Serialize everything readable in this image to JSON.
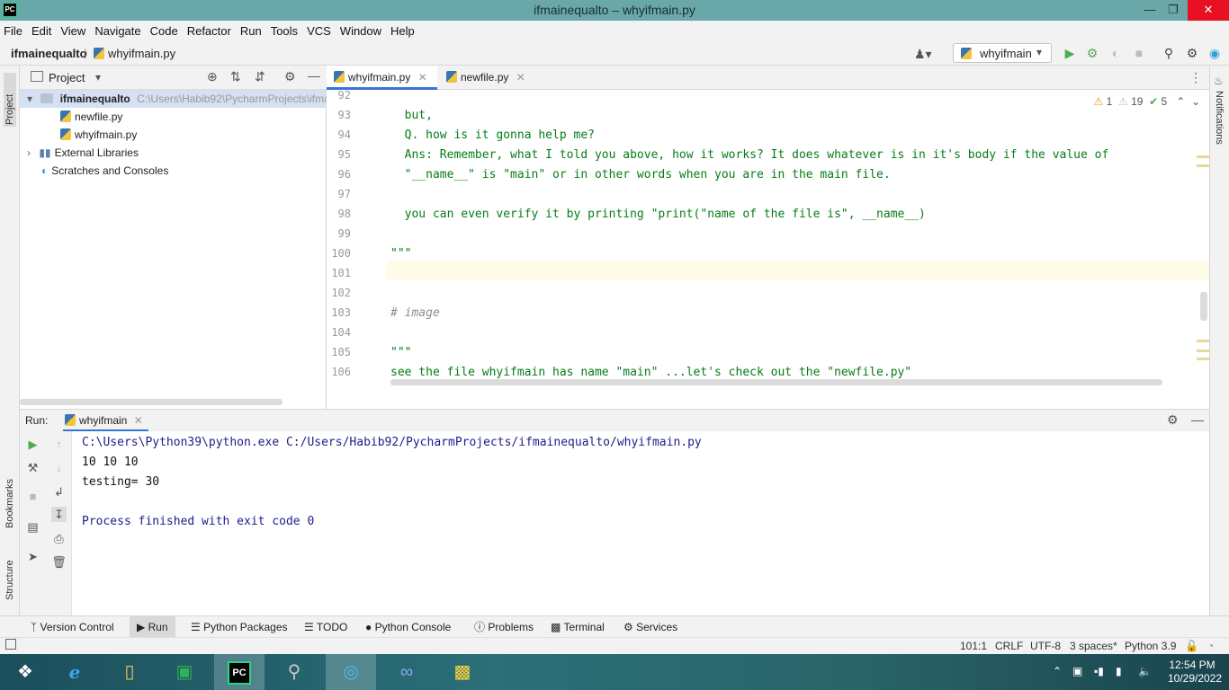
{
  "window": {
    "title": "ifmainequalto – whyifmain.py",
    "app_badge": "PC"
  },
  "menu": [
    "File",
    "Edit",
    "View",
    "Navigate",
    "Code",
    "Refactor",
    "Run",
    "Tools",
    "VCS",
    "Window",
    "Help"
  ],
  "breadcrumb": {
    "project": "ifmainequalto",
    "file": "whyifmain.py"
  },
  "run_config": {
    "name": "whyifmain"
  },
  "left_stripe": {
    "project": "Project",
    "bookmarks": "Bookmarks",
    "structure": "Structure"
  },
  "right_stripe": {
    "notifications": "Notifications"
  },
  "project_panel": {
    "title": "Project",
    "root": {
      "name": "ifmainequalto",
      "path": "C:\\Users\\Habib92\\PycharmProjects\\ifma"
    },
    "files": [
      "newfile.py",
      "whyifmain.py"
    ],
    "external": "External Libraries",
    "scratches": "Scratches and Consoles"
  },
  "editor": {
    "tabs": [
      {
        "label": "whyifmain.py",
        "active": true
      },
      {
        "label": "newfile.py",
        "active": false
      }
    ],
    "inspections": {
      "warnings": "1",
      "weak": "19",
      "ok": "5"
    },
    "lines": [
      {
        "n": "92",
        "text": "",
        "cls": "str"
      },
      {
        "n": "93",
        "text": "  but,",
        "cls": "str"
      },
      {
        "n": "94",
        "text": "  Q. how is it gonna help me?",
        "cls": "str"
      },
      {
        "n": "95",
        "text": "  Ans: Remember, what I told you above, how it works? It does whatever is in it's body if the value of",
        "cls": "str"
      },
      {
        "n": "96",
        "text": "  \"__name__\" is \"main\" or in other words when you are in the main file.",
        "cls": "str"
      },
      {
        "n": "97",
        "text": "",
        "cls": "str"
      },
      {
        "n": "98",
        "text": "  you can even verify it by printing \"print(\"name of the file is\", __name__)",
        "cls": "str"
      },
      {
        "n": "99",
        "text": "",
        "cls": "str"
      },
      {
        "n": "100",
        "text": "\"\"\"",
        "cls": "str"
      },
      {
        "n": "101",
        "text": "",
        "cls": "str"
      },
      {
        "n": "102",
        "text": "",
        "cls": "str"
      },
      {
        "n": "103",
        "text": "# image",
        "cls": "cm"
      },
      {
        "n": "104",
        "text": "",
        "cls": "str"
      },
      {
        "n": "105",
        "text": "\"\"\"",
        "cls": "str"
      },
      {
        "n": "106",
        "text": "see the file whyifmain has name \"main\" ...let's check out the \"newfile.py\"",
        "cls": "str"
      }
    ]
  },
  "run_panel": {
    "label": "Run:",
    "tab": "whyifmain",
    "output": [
      "C:\\Users\\Python39\\python.exe C:/Users/Habib92/PycharmProjects/ifmainequalto/whyifmain.py",
      "10 10 10",
      "testing= 30",
      "",
      "Process finished with exit code 0"
    ]
  },
  "bottom_tabs": [
    "Version Control",
    "Run",
    "Python Packages",
    "TODO",
    "Python Console",
    "Problems",
    "Terminal",
    "Services"
  ],
  "status": {
    "position": "101:1",
    "line_sep": "CRLF",
    "encoding": "UTF-8",
    "indent": "3 spaces*",
    "interpreter": "Python 3.9"
  },
  "taskbar": {
    "time": "12:54 PM",
    "date": "10/29/2022"
  },
  "colors": {
    "accent": "#3874d8",
    "string": "#067d17",
    "titlebar": "#6aa7a8",
    "close": "#e81123"
  }
}
